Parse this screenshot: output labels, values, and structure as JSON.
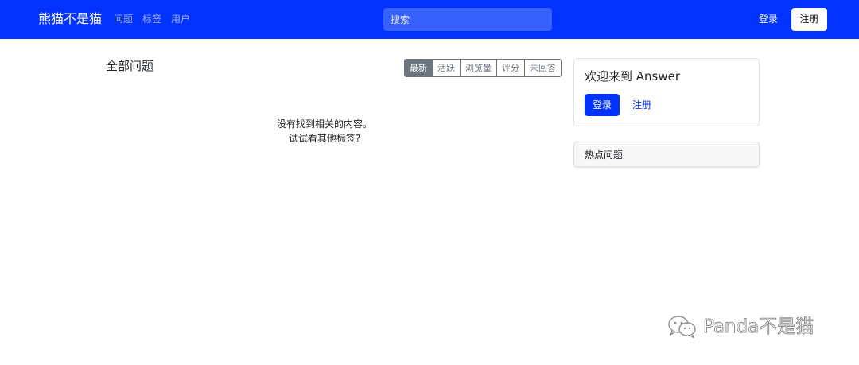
{
  "navbar": {
    "brand": "熊猫不是猫",
    "links": [
      "问题",
      "标签",
      "用户"
    ],
    "search_placeholder": "搜索",
    "login_label": "登录",
    "signup_label": "注册"
  },
  "main": {
    "title": "全部问题",
    "sort_tabs": [
      {
        "label": "最新",
        "active": true
      },
      {
        "label": "活跃",
        "active": false
      },
      {
        "label": "浏览量",
        "active": false
      },
      {
        "label": "评分",
        "active": false
      },
      {
        "label": "未回答",
        "active": false
      }
    ],
    "empty_line1": "没有找到相关的内容。",
    "empty_line2": "试试看其他标签?"
  },
  "sidebar": {
    "welcome_title": "欢迎来到 Answer",
    "login_label": "登录",
    "signup_label": "注册",
    "hot_title": "热点问题"
  },
  "watermark": {
    "icon": "wechat-icon",
    "text": "Panda不是猫"
  },
  "colors": {
    "primary": "#0033ff",
    "secondary": "#6c757d"
  }
}
